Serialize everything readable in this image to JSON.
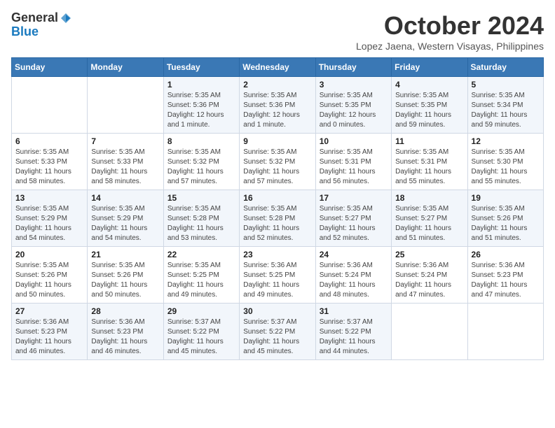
{
  "logo": {
    "line1": "General",
    "line2": "Blue"
  },
  "title": "October 2024",
  "subtitle": "Lopez Jaena, Western Visayas, Philippines",
  "days_of_week": [
    "Sunday",
    "Monday",
    "Tuesday",
    "Wednesday",
    "Thursday",
    "Friday",
    "Saturday"
  ],
  "weeks": [
    [
      {
        "day": "",
        "info": ""
      },
      {
        "day": "",
        "info": ""
      },
      {
        "day": "1",
        "info": "Sunrise: 5:35 AM\nSunset: 5:36 PM\nDaylight: 12 hours\nand 1 minute."
      },
      {
        "day": "2",
        "info": "Sunrise: 5:35 AM\nSunset: 5:36 PM\nDaylight: 12 hours\nand 1 minute."
      },
      {
        "day": "3",
        "info": "Sunrise: 5:35 AM\nSunset: 5:35 PM\nDaylight: 12 hours\nand 0 minutes."
      },
      {
        "day": "4",
        "info": "Sunrise: 5:35 AM\nSunset: 5:35 PM\nDaylight: 11 hours\nand 59 minutes."
      },
      {
        "day": "5",
        "info": "Sunrise: 5:35 AM\nSunset: 5:34 PM\nDaylight: 11 hours\nand 59 minutes."
      }
    ],
    [
      {
        "day": "6",
        "info": "Sunrise: 5:35 AM\nSunset: 5:33 PM\nDaylight: 11 hours\nand 58 minutes."
      },
      {
        "day": "7",
        "info": "Sunrise: 5:35 AM\nSunset: 5:33 PM\nDaylight: 11 hours\nand 58 minutes."
      },
      {
        "day": "8",
        "info": "Sunrise: 5:35 AM\nSunset: 5:32 PM\nDaylight: 11 hours\nand 57 minutes."
      },
      {
        "day": "9",
        "info": "Sunrise: 5:35 AM\nSunset: 5:32 PM\nDaylight: 11 hours\nand 57 minutes."
      },
      {
        "day": "10",
        "info": "Sunrise: 5:35 AM\nSunset: 5:31 PM\nDaylight: 11 hours\nand 56 minutes."
      },
      {
        "day": "11",
        "info": "Sunrise: 5:35 AM\nSunset: 5:31 PM\nDaylight: 11 hours\nand 55 minutes."
      },
      {
        "day": "12",
        "info": "Sunrise: 5:35 AM\nSunset: 5:30 PM\nDaylight: 11 hours\nand 55 minutes."
      }
    ],
    [
      {
        "day": "13",
        "info": "Sunrise: 5:35 AM\nSunset: 5:29 PM\nDaylight: 11 hours\nand 54 minutes."
      },
      {
        "day": "14",
        "info": "Sunrise: 5:35 AM\nSunset: 5:29 PM\nDaylight: 11 hours\nand 54 minutes."
      },
      {
        "day": "15",
        "info": "Sunrise: 5:35 AM\nSunset: 5:28 PM\nDaylight: 11 hours\nand 53 minutes."
      },
      {
        "day": "16",
        "info": "Sunrise: 5:35 AM\nSunset: 5:28 PM\nDaylight: 11 hours\nand 52 minutes."
      },
      {
        "day": "17",
        "info": "Sunrise: 5:35 AM\nSunset: 5:27 PM\nDaylight: 11 hours\nand 52 minutes."
      },
      {
        "day": "18",
        "info": "Sunrise: 5:35 AM\nSunset: 5:27 PM\nDaylight: 11 hours\nand 51 minutes."
      },
      {
        "day": "19",
        "info": "Sunrise: 5:35 AM\nSunset: 5:26 PM\nDaylight: 11 hours\nand 51 minutes."
      }
    ],
    [
      {
        "day": "20",
        "info": "Sunrise: 5:35 AM\nSunset: 5:26 PM\nDaylight: 11 hours\nand 50 minutes."
      },
      {
        "day": "21",
        "info": "Sunrise: 5:35 AM\nSunset: 5:26 PM\nDaylight: 11 hours\nand 50 minutes."
      },
      {
        "day": "22",
        "info": "Sunrise: 5:35 AM\nSunset: 5:25 PM\nDaylight: 11 hours\nand 49 minutes."
      },
      {
        "day": "23",
        "info": "Sunrise: 5:36 AM\nSunset: 5:25 PM\nDaylight: 11 hours\nand 49 minutes."
      },
      {
        "day": "24",
        "info": "Sunrise: 5:36 AM\nSunset: 5:24 PM\nDaylight: 11 hours\nand 48 minutes."
      },
      {
        "day": "25",
        "info": "Sunrise: 5:36 AM\nSunset: 5:24 PM\nDaylight: 11 hours\nand 47 minutes."
      },
      {
        "day": "26",
        "info": "Sunrise: 5:36 AM\nSunset: 5:23 PM\nDaylight: 11 hours\nand 47 minutes."
      }
    ],
    [
      {
        "day": "27",
        "info": "Sunrise: 5:36 AM\nSunset: 5:23 PM\nDaylight: 11 hours\nand 46 minutes."
      },
      {
        "day": "28",
        "info": "Sunrise: 5:36 AM\nSunset: 5:23 PM\nDaylight: 11 hours\nand 46 minutes."
      },
      {
        "day": "29",
        "info": "Sunrise: 5:37 AM\nSunset: 5:22 PM\nDaylight: 11 hours\nand 45 minutes."
      },
      {
        "day": "30",
        "info": "Sunrise: 5:37 AM\nSunset: 5:22 PM\nDaylight: 11 hours\nand 45 minutes."
      },
      {
        "day": "31",
        "info": "Sunrise: 5:37 AM\nSunset: 5:22 PM\nDaylight: 11 hours\nand 44 minutes."
      },
      {
        "day": "",
        "info": ""
      },
      {
        "day": "",
        "info": ""
      }
    ]
  ]
}
